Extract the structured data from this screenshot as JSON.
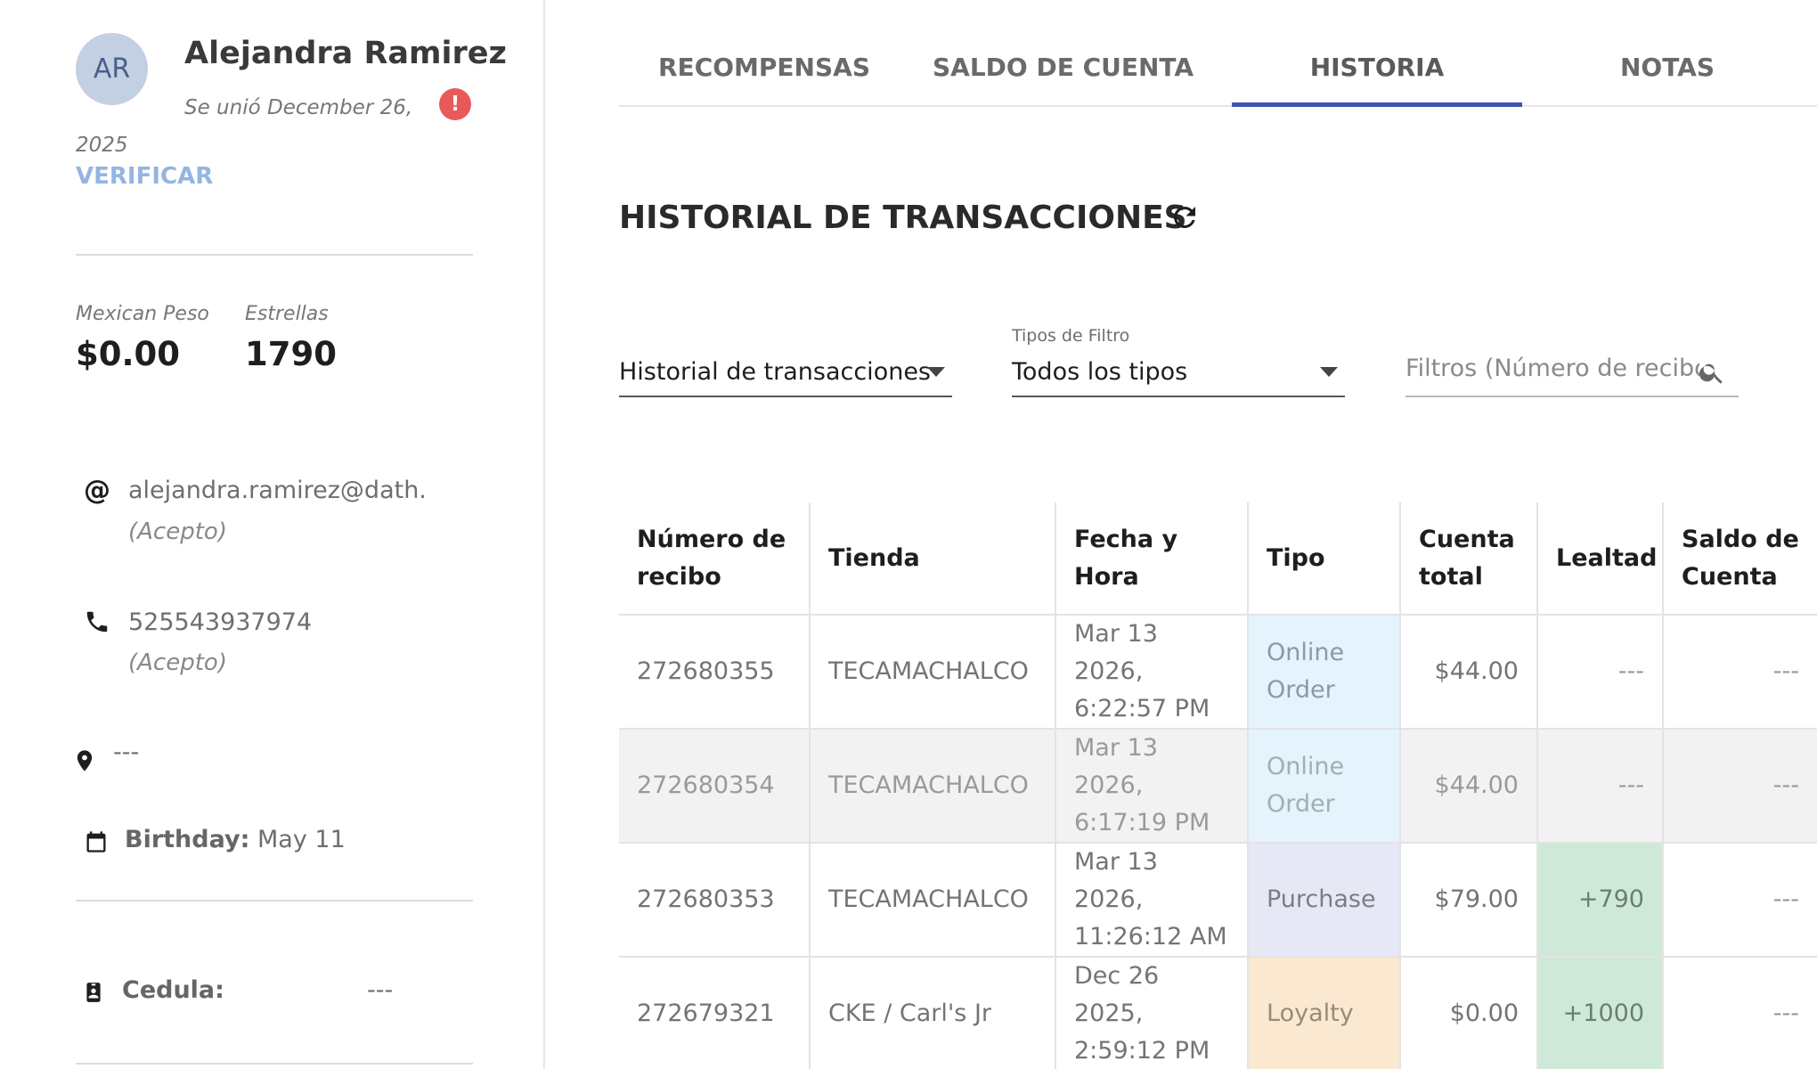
{
  "profile": {
    "initials": "AR",
    "name": "Alejandra Ramirez",
    "joined": "Se unió December 26, 2025",
    "verify_label": "VERIFICAR",
    "currency_label": "Mexican Peso",
    "currency_value": "$0.00",
    "stars_label": "Estrellas",
    "stars_value": "1790",
    "email": "alejandra.ramirez@dath.",
    "email_status": "(Acepto)",
    "phone": "525543937974",
    "phone_status": "(Acepto)",
    "address": "---",
    "birthday_label": "Birthday:",
    "birthday_value": "May 11",
    "cedula_label": "Cedula:",
    "cedula_value": "---"
  },
  "tabs": [
    {
      "label": "RECOMPENSAS",
      "active": false
    },
    {
      "label": "SALDO DE CUENTA",
      "active": false
    },
    {
      "label": "HISTORIA",
      "active": true
    },
    {
      "label": "NOTAS",
      "active": false
    }
  ],
  "history": {
    "title": "HISTORIAL DE TRANSACCIONES",
    "history_select_value": "Historial de transacciones",
    "filter_type_label": "Tipos de Filtro",
    "filter_type_value": "Todos los tipos",
    "search_placeholder": "Filtros (Número de recibo, T..."
  },
  "table": {
    "headers": [
      "Número de recibo",
      "Tienda",
      "Fecha y Hora",
      "Tipo",
      "Cuenta total",
      "Lealtad",
      "Saldo de Cuenta"
    ],
    "rows": [
      {
        "receipt": "272680355",
        "store": "TECAMACHALCO",
        "date": "Mar 13 2026,",
        "time": "6:22:57 PM",
        "type": "Online Order",
        "total": "$44.00",
        "loyalty": "---",
        "balance": "---"
      },
      {
        "receipt": "272680354",
        "store": "TECAMACHALCO",
        "date": "Mar 13 2026,",
        "time": "6:17:19 PM",
        "type": "Online Order",
        "total": "$44.00",
        "loyalty": "---",
        "balance": "---"
      },
      {
        "receipt": "272680353",
        "store": "TECAMACHALCO",
        "date": "Mar 13 2026,",
        "time": "11:26:12 AM",
        "type": "Purchase",
        "total": "$79.00",
        "loyalty": "+790",
        "balance": "---"
      },
      {
        "receipt": "272679321",
        "store": "CKE / Carl's Jr",
        "date": "Dec 26 2025,",
        "time": "2:59:12 PM",
        "type": "Loyalty",
        "total": "$0.00",
        "loyalty": "+1000",
        "balance": "---"
      }
    ]
  },
  "colors": {
    "accent": "#3d55b0",
    "verify": "#94b5e0",
    "alert": "#e85a5a",
    "online_order_bg": "#e4f3fc",
    "purchase_bg": "#e7e8f6",
    "loyalty_bg": "#fbe8d0",
    "positive_bg": "#cfe9d8"
  },
  "icons": {
    "refresh": "refresh-icon",
    "search": "search-icon",
    "email": "at-icon",
    "phone": "phone-icon",
    "address": "location-pin-icon",
    "birthday": "calendar-icon",
    "cedula": "id-badge-icon",
    "alert": "alert-icon"
  }
}
